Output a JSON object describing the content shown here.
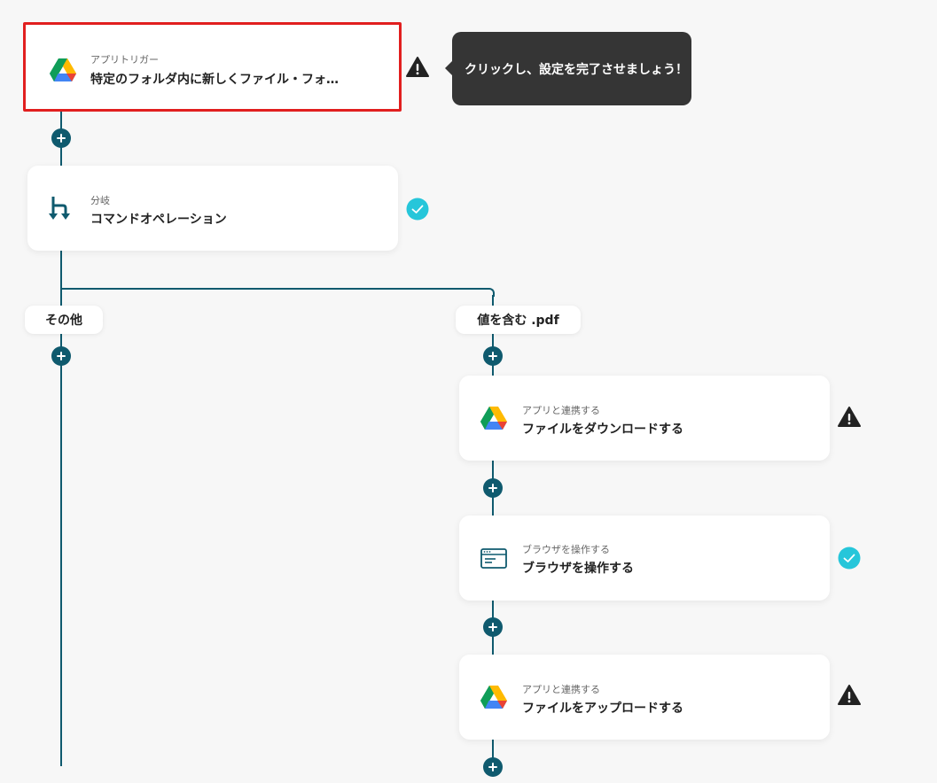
{
  "tooltip": {
    "text": "クリックし、設定を完了させましょう！"
  },
  "trigger_card": {
    "subtitle": "アプリトリガー",
    "title": "特定のフォルダ内に新しくファイル・フォ…",
    "icon": "google-drive-icon",
    "status": "warning"
  },
  "branch_card": {
    "subtitle": "分岐",
    "title": "コマンドオペレーション",
    "icon": "branch-icon",
    "status": "complete"
  },
  "branches": {
    "other_label": "その他",
    "condition_label": "値を含む .pdf"
  },
  "steps": [
    {
      "subtitle": "アプリと連携する",
      "title": "ファイルをダウンロードする",
      "icon": "google-drive-icon",
      "status": "warning"
    },
    {
      "subtitle": "ブラウザを操作する",
      "title": "ブラウザを操作する",
      "icon": "browser-window-icon",
      "status": "complete"
    },
    {
      "subtitle": "アプリと連携する",
      "title": "ファイルをアップロードする",
      "icon": "google-drive-icon",
      "status": "warning"
    }
  ],
  "colors": {
    "line": "#0f5a6e",
    "check": "#26c6da",
    "warning": "#222222",
    "selected_border": "#e11f1f",
    "tooltip_bg": "#353535"
  }
}
